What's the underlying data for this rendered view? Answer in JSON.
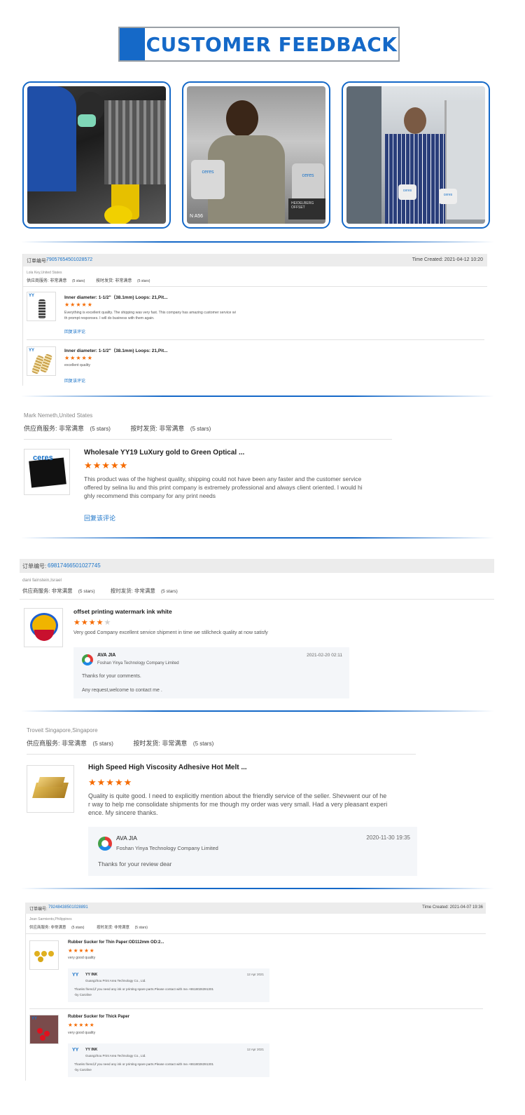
{
  "banner": {
    "title": "CUSTOMER FEEDBACK"
  },
  "photos": [
    {
      "caption": ""
    },
    {
      "caption": "ceres",
      "sign": "HEIDELBERG OFFSET",
      "label": "N A56"
    },
    {
      "caption": "ceres"
    }
  ],
  "review1": {
    "order_label": "订单编号:",
    "order_no": "79057654501028572",
    "time_created": "Time Created: 2021-04-12 10:20",
    "reviewer": "Lola Key,United States",
    "supplier_service": "供应商服务: 非常满意",
    "supplier_stars": "(5 stars)",
    "ontime": "按时发货: 非常满意",
    "ontime_stars": "(5 stars)",
    "items": [
      {
        "title": "Inner diameter: 1-1/2\"（38.1mm) Loops: 21,Pit...",
        "stars": "★★★★★",
        "text1": "Everything is excellent quality. The shipping was very fast. This company has amazing customer service wi",
        "text2": "th prompt responses. I will do business with them again.",
        "reply_link": "回复该评论"
      },
      {
        "title": "Inner diameter: 1-1/2\"（38.1mm) Loops: 21,Pit...",
        "stars": "★★★★★",
        "text1": "excellent quality",
        "reply_link": "回复该评论"
      }
    ]
  },
  "review2": {
    "reviewer": "Mark Nemeth,United States",
    "supplier_service": "供应商服务: 非常满意",
    "supplier_stars": "(5 stars)",
    "ontime": "按时发货: 非常满意",
    "ontime_stars": "(5 stars)",
    "title": "Wholesale YY19 LuXury gold to Green Optical ...",
    "stars": "★★★★★",
    "line1": "This product was of the highest quality, shipping could not have been any faster and the customer service",
    "line2": "offered by selina liu and this print company is extremely professional and always client oriented. I would hi",
    "line3": "ghly recommend this company for any print needs",
    "reply_link": "回复该评论",
    "thumb_text": "ceres"
  },
  "review3": {
    "order_label": "订单编号:",
    "order_no": "69817466501027745",
    "reviewer": "dani fainstein,Israel",
    "supplier_service": "供应商服务: 非常满意",
    "supplier_stars": "(5 stars)",
    "ontime": "按时发货: 非常满意",
    "ontime_stars": "(5 stars)",
    "title": "offset printing watermark ink white",
    "stars_on": "★★★★",
    "stars_off": "★",
    "text": "Very good Company excellent service shipment in time we stillcheck quality at now satisfy",
    "reply": {
      "name": "AVA JIA",
      "company": "Foshan Yinya Technology Company Limited",
      "date": "2021-02-20 02:11",
      "line1": "Thanks for your comments.",
      "line2": "Any request,welcome to contact me ."
    }
  },
  "review4": {
    "reviewer": "Troveit Singapore,Singapore",
    "supplier_service": "供应商服务: 非常满意",
    "supplier_stars": "(5 stars)",
    "ontime": "按时发货: 非常满意",
    "ontime_stars": "(5 stars)",
    "title": "High Speed High Viscosity Adhesive Hot Melt ...",
    "stars": "★★★★★",
    "line1": "Quality is quite good. I need to explicitly mention about the friendly service of the seller. Shevwent our of he",
    "line2": "r way to help me consolidate shipments for me though my order was very small. Had a very pleasant experi",
    "line3": "ence. My sincere thanks.",
    "reply": {
      "name": "AVA JIA",
      "company": "Foshan Yinya Technology Company Limited",
      "date": "2020-11-30 19:35",
      "line1": "Thanks for your review dear"
    }
  },
  "review5": {
    "order_label": "订单编号:",
    "order_no": "79248438501028891",
    "time_created": "Time Created: 2021-04-07 19:36",
    "reviewer": "Jean Sarmiento,Philippines",
    "supplier_service": "供应商服务: 非常满意",
    "supplier_stars": "(5 stars)",
    "ontime": "按时发货: 非常满意",
    "ontime_stars": "(5 stars)",
    "items": [
      {
        "title": "Rubber Sucker for Thin Paper:OD112mm OD:2...",
        "stars": "★★★★★",
        "text": "very good quality",
        "reply": {
          "name": "YY INK",
          "company": "Guangzhou Print Area Technology Co., Ltd.",
          "date": "12 Apr 2021",
          "line1": "Thanks friend,if you need any ink or printing spare parts.Please contact with me.+8618026391301",
          "line2": "-by Caroline"
        }
      },
      {
        "title": "Rubber Sucker for Thick Paper",
        "stars": "★★★★★",
        "text": "very good quality",
        "reply": {
          "name": "YY INK",
          "company": "Guangzhou Print Area Technology Co., Ltd.",
          "date": "12 Apr 2021",
          "line1": "Thanks friend,if you need any ink or printing spare parts.Please contact with me.+8618026391301",
          "line2": "-by Caroline"
        }
      }
    ]
  }
}
